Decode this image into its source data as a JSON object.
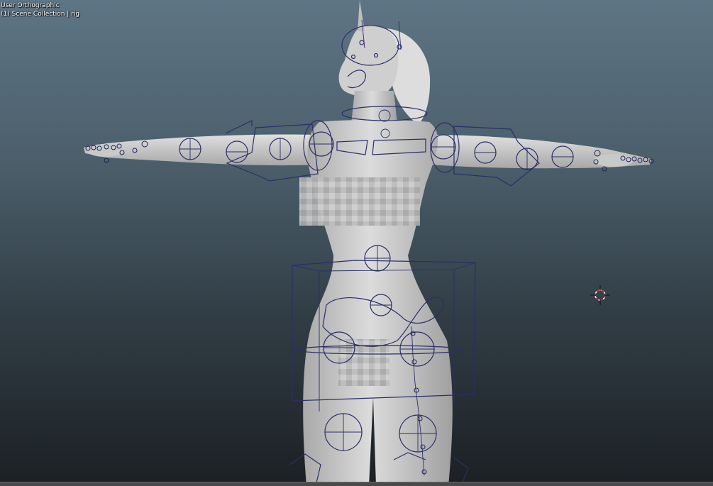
{
  "viewport": {
    "view_name": "User Orthographic",
    "collection_info": "(1) Scene Collection | rig"
  },
  "icons": {
    "cursor": "3d-cursor-icon"
  },
  "colors": {
    "background_top": "#5e7585",
    "background_bottom": "#1b2024",
    "mesh": "#d4d4d4",
    "rig": "#2b2f66",
    "cursor_red": "#c0392b"
  }
}
